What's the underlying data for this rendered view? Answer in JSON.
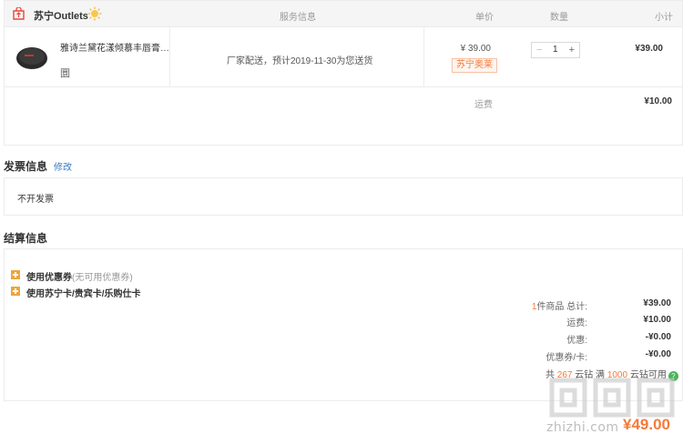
{
  "store": {
    "name": "苏宁Outlets"
  },
  "columns": {
    "service": "服务信息",
    "unit_price": "单价",
    "quantity": "数量",
    "subtotal": "小计"
  },
  "item": {
    "title": "雅诗兰黛花漾倾慕丰唇膏1 ...",
    "sub": "圜",
    "delivery": "厂家配送，预计2019-11-30为您送货",
    "unit_price": "¥ 39.00",
    "promo": "苏宁奥莱",
    "qty_minus": "−",
    "qty": "1",
    "qty_plus": "+",
    "subtotal": "¥39.00"
  },
  "freight": {
    "label": "运费",
    "value": "¥10.00"
  },
  "invoice": {
    "title": "发票信息",
    "edit": "修改",
    "value": "不开发票"
  },
  "settlement": {
    "title": "结算信息",
    "coupon_label": "使用优惠券",
    "coupon_note": "(无可用优惠券)",
    "card_label": "使用苏宁卡/贵宾卡/乐购仕卡",
    "count_num": "1",
    "count_suffix": "件商品 总计:",
    "total_value": "¥39.00",
    "freight_label": "运费:",
    "freight_value": "¥10.00",
    "discount_label": "优惠:",
    "discount_value": "-¥0.00",
    "coupon_card_label": "优惠券/卡:",
    "coupon_card_value": "-¥0.00",
    "points_prefix": "共",
    "points_a": "267",
    "points_mid": "云钻 满",
    "points_b": "1000",
    "points_suffix": "云钻可用",
    "help": "?"
  },
  "pay_total": "¥49.00",
  "watermark": "zhizhi.com",
  "colors": {
    "accent": "#f47a3a",
    "link": "#3a78c3",
    "border": "#ececec",
    "header_bg": "#f5f5f5"
  }
}
